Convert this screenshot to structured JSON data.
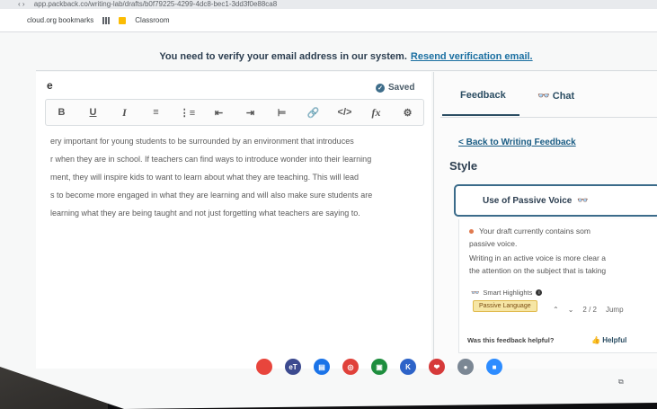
{
  "browser": {
    "url": "app.packback.co/writing-lab/drafts/b0f79225-4299-4dc8-bec1-3dd3f0e88ca8",
    "bookmarks": [
      "cloud.org bookmarks",
      "Classroom"
    ]
  },
  "banner": {
    "message": "You need to verify your email address in our system.",
    "link": "Resend verification email."
  },
  "editor": {
    "title": "e",
    "saved": "Saved",
    "toolbar": [
      "B",
      "U",
      "I",
      "≡",
      "⋮≡",
      "⇤",
      "⇥",
      "⊨",
      "🔗",
      "</>",
      "fx",
      "⚙"
    ],
    "lines": [
      "ery important for young students to be surrounded by an environment that introduces",
      "r when they are in school. If teachers can find ways to introduce wonder into their learning",
      "ment, they will inspire kids to want to learn about what they are teaching. This will lead",
      "s to become more engaged in what they are learning and will also make sure students are",
      "learning what they are being taught and not just forgetting what teachers are saying to."
    ]
  },
  "feedback": {
    "tab_feedback": "Feedback",
    "tab_chat": "Chat",
    "back_link": "< Back to Writing Feedback",
    "section": "Style",
    "card_title": "Use of Passive Voice",
    "text_1": "Your draft currently contains som",
    "text_2": "passive voice.",
    "text_3": "Writing in an active voice is more clear a",
    "text_4": "the attention on the subject that is taking",
    "smart_label": "Smart Highlights",
    "chip": "Passive Language",
    "pager": "2 / 2",
    "jump": "Jump",
    "helpful_q": "Was this feedback helpful?",
    "helpful_btn": "Helpful"
  },
  "shelf": {
    "apps": [
      {
        "name": "chrome-icon",
        "color": "#e8453c",
        "label": ""
      },
      {
        "name": "et-icon",
        "color": "#3c4a8f",
        "label": "eT"
      },
      {
        "name": "docs-icon",
        "color": "#1a73e8",
        "label": "▤"
      },
      {
        "name": "screencastify-icon",
        "color": "#e0413a",
        "label": "◎"
      },
      {
        "name": "classroom-icon",
        "color": "#1e8e3e",
        "label": "▣"
      },
      {
        "name": "kami-icon",
        "color": "#2d63c8",
        "label": "K"
      },
      {
        "name": "pocket-icon",
        "color": "#d63a3a",
        "label": "❤"
      },
      {
        "name": "app-icon",
        "color": "#7b8794",
        "label": "●"
      },
      {
        "name": "zoom-icon",
        "color": "#2d8cff",
        "label": "■"
      }
    ]
  },
  "colors": {
    "accent": "#2c4e63",
    "link": "#1a6fa1",
    "underline_error": "#c0392b"
  }
}
